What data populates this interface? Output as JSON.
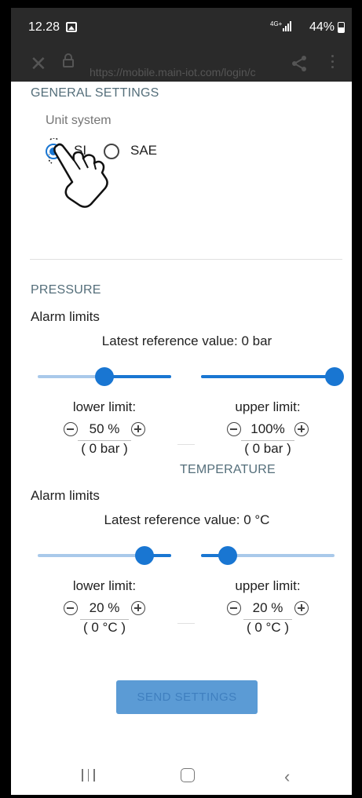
{
  "status_bar": {
    "time": "12.28",
    "network": "4G+",
    "battery": "44%"
  },
  "browser": {
    "url": "https://mobile.main-iot.com/login/c"
  },
  "general": {
    "title": "GENERAL SETTINGS",
    "unit_label": "Unit system",
    "options": [
      "SI",
      "SAE"
    ],
    "selected": "SI"
  },
  "pressure": {
    "title": "PRESSURE",
    "alarm_label": "Alarm limits",
    "reference": "Latest reference value: 0 bar",
    "lower": {
      "label": "lower limit:",
      "value": "50",
      "unit": "%",
      "converted": "( 0 bar )",
      "slider_fraction": 0.5
    },
    "upper": {
      "label": "upper limit:",
      "value": "100",
      "unit": "%",
      "converted": "( 0 bar )",
      "slider_fraction": 1.0
    }
  },
  "temperature": {
    "title": "TEMPERATURE",
    "alarm_label": "Alarm limits",
    "reference": "Latest reference value: 0 °C",
    "lower": {
      "label": "lower limit:",
      "value": "20",
      "unit": "%",
      "converted": "( 0 °C )",
      "slider_fraction": 0.8
    },
    "upper": {
      "label": "upper limit:",
      "value": "20",
      "unit": "%",
      "converted": "( 0 °C )",
      "slider_fraction": 0.2
    }
  },
  "actions": {
    "send": "SEND SETTINGS"
  },
  "colors": {
    "accent": "#1976d2",
    "section_title": "#546e7a",
    "button_bg": "#5b9bd5"
  }
}
